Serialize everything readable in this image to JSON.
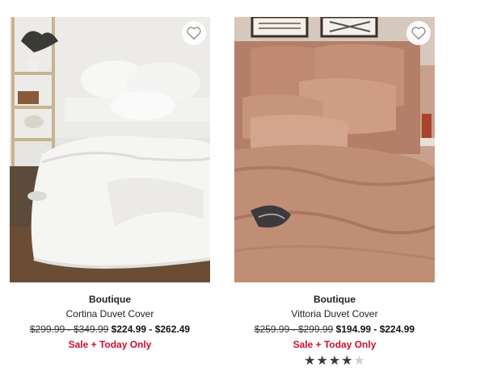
{
  "products": [
    {
      "brand": "Boutique",
      "name": "Cortina Duvet Cover",
      "price_old": "$299.99 - $349.99",
      "price_now": "$224.99 - $262.49",
      "promo": "Sale + Today Only",
      "wishlist_icon": "heart-outline-icon"
    },
    {
      "brand": "Boutique",
      "name": "Vittoria Duvet Cover",
      "price_old": "$259.99 - $299.99",
      "price_now": "$194.99 - $224.99",
      "promo": "Sale + Today Only",
      "wishlist_icon": "heart-outline-icon",
      "rating": 4,
      "rating_max": 5
    }
  ],
  "colors": {
    "promo": "#c8102e",
    "star_filled": "#3a3a3a",
    "star_empty": "#cfcfcf"
  }
}
